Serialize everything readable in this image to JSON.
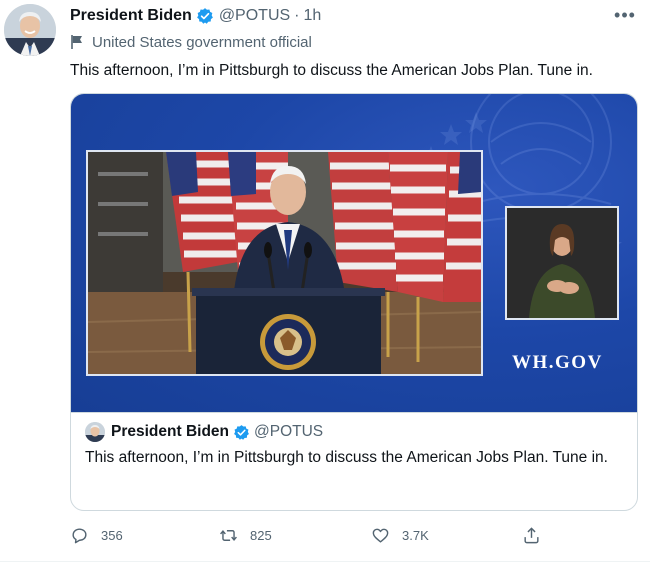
{
  "author": {
    "name": "President Biden",
    "handle": "@POTUS",
    "separator": "·",
    "time": "1h",
    "label": "United States government official"
  },
  "tweet": {
    "text": "This afternoon, I’m in Pittsburgh to discuss the American Jobs Plan. Tune in."
  },
  "media": {
    "watermark": "WH.GOV"
  },
  "quoted_tweet": {
    "name": "President Biden",
    "handle": "@POTUS",
    "text": "This afternoon, I’m in Pittsburgh to discuss the American Jobs Plan. Tune in."
  },
  "actions": {
    "replies": "356",
    "retweets": "825",
    "likes": "3.7K"
  },
  "more_menu": "•••",
  "colors": {
    "verified": "#1d9bf0",
    "secondary_text": "#536471",
    "primary_text": "#0f1419",
    "border": "#cfd9de",
    "media_blue": "#1d47a8"
  },
  "icons": [
    "verified-badge-icon",
    "flag-icon",
    "more-icon",
    "reply-icon",
    "retweet-icon",
    "like-icon",
    "share-icon"
  ]
}
